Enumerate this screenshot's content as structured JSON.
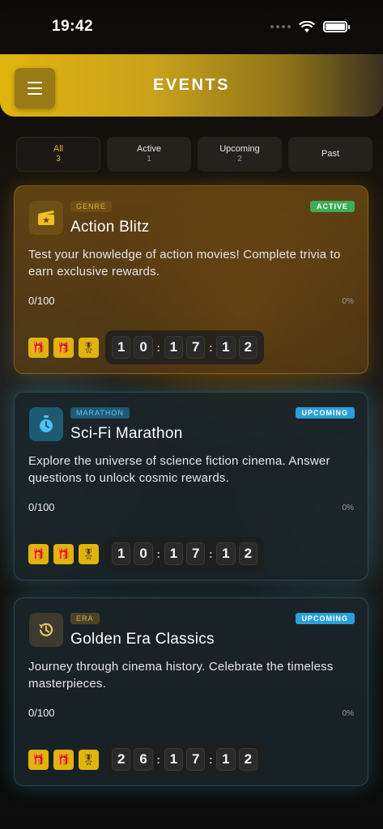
{
  "status_bar": {
    "time": "19:42"
  },
  "header": {
    "title": "EVENTS"
  },
  "tabs": [
    {
      "label": "All",
      "count": "3",
      "selected": true
    },
    {
      "label": "Active",
      "count": "1",
      "selected": false
    },
    {
      "label": "Upcoming",
      "count": "2",
      "selected": false
    },
    {
      "label": "Past",
      "count": "",
      "selected": false
    }
  ],
  "events": [
    {
      "category": "GENRE",
      "status": "ACTIVE",
      "title": "Action Blitz",
      "description": "Test your knowledge of action movies! Complete trivia to earn exclusive rewards.",
      "progress": "0/100",
      "percent": "0%",
      "timer": [
        "1",
        "0",
        "1",
        "7",
        "1",
        "2"
      ],
      "icon": "clapperboard-icon"
    },
    {
      "category": "MARATHON",
      "status": "UPCOMING",
      "title": "Sci-Fi Marathon",
      "description": "Explore the universe of science fiction cinema. Answer questions to unlock cosmic rewards.",
      "progress": "0/100",
      "percent": "0%",
      "timer": [
        "1",
        "0",
        "1",
        "7",
        "1",
        "2"
      ],
      "icon": "stopwatch-icon"
    },
    {
      "category": "ERA",
      "status": "UPCOMING",
      "title": "Golden Era Classics",
      "description": "Journey through cinema history. Celebrate the timeless masterpieces.",
      "progress": "0/100",
      "percent": "0%",
      "timer": [
        "2",
        "6",
        "1",
        "7",
        "1",
        "2"
      ],
      "icon": "history-icon"
    }
  ],
  "colors": {
    "accent": "#e0b40f",
    "active_badge": "#3cae54",
    "upcoming_badge": "#2b9fd8"
  }
}
